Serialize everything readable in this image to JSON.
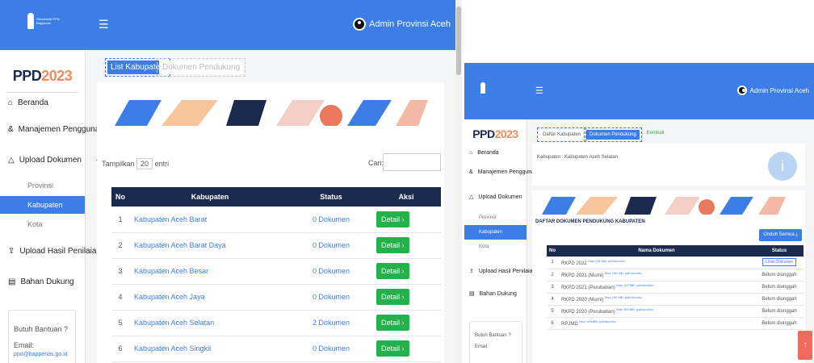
{
  "left": {
    "brand_line1": "Sekretariat PPD",
    "brand_line2": "Bappenas",
    "user_name": "Admin Provinsi Aceh",
    "logo_main": "PPD",
    "logo_year": "2023",
    "menu": {
      "beranda": "Beranda",
      "manajemen": "Manajemen Pengguna",
      "manajemen_toggle": "+",
      "upload": "Upload Dokumen",
      "upload_toggle": "–",
      "sub_provinsi": "Provinsi",
      "sub_kabupaten": "Kabupaten",
      "sub_kota": "Kota",
      "upload_hasil": "Upload Hasil Penilaian",
      "bahan": "Bahan Dukung"
    },
    "help": {
      "title": "Butuh Bantuan ?",
      "email_label": "Email:",
      "email": "ppd@bappenas.go.id"
    },
    "tabs": {
      "list": "List Kabupaten",
      "dok": "Dokumen Pendukung"
    },
    "length_prefix": "Tampilkan",
    "length_value": "20",
    "length_suffix": "entri",
    "search_label": "Cari:",
    "table": {
      "headers": [
        "No",
        "Kabupaten",
        "Status",
        "Aksi"
      ],
      "detail_label": "Detail ›",
      "rows": [
        {
          "no": "1",
          "name": "Kabupaten Aceh Barat",
          "status": "0 Dokumen"
        },
        {
          "no": "2",
          "name": "Kabupaten Aceh Barat Daya",
          "status": "0 Dokumen"
        },
        {
          "no": "3",
          "name": "Kabupaten Aceh Besar",
          "status": "0 Dokumen"
        },
        {
          "no": "4",
          "name": "Kabupaten Aceh Jaya",
          "status": "0 Dokumen"
        },
        {
          "no": "5",
          "name": "Kabupaten Aceh Selatan",
          "status": "2 Dokumen"
        },
        {
          "no": "6",
          "name": "Kabupaten Aceh Singkil",
          "status": "0 Dokumen"
        }
      ]
    }
  },
  "right": {
    "user_name": "Admin Provinsi Aceh",
    "logo_main": "PPD",
    "logo_year": "2023",
    "menu": {
      "beranda": "Beranda",
      "manajemen": "Manajemen Pengguna",
      "manajemen_toggle": "+",
      "upload": "Upload Dokumen",
      "upload_toggle": "–",
      "sub_provinsi": "Provinsi",
      "sub_kabupaten": "Kabupaten",
      "sub_kota": "Kota",
      "upload_hasil": "Upload Hasil Penilaian",
      "bahan": "Bahan Dukung"
    },
    "help": {
      "title": "Butuh Bantuan ?",
      "email_label": "Email:"
    },
    "tabs": {
      "daftar": "Daftar Kabupaten",
      "dok": "Dokumen Pendukung",
      "back": "← Kembali"
    },
    "kab_label": "Kabupaten : Kabupaten Aceh Selatan",
    "section_title": "DAFTAR DOKUMEN PENDUKUNG KABUPATEN",
    "unduh_label": "Unduh Semua",
    "table": {
      "headers": [
        "No",
        "Nama Dokumen",
        "Status"
      ],
      "rows": [
        {
          "no": "1",
          "name": "RKPD 2022",
          "note": "Max 100 MB, pdf/doc/xlsx",
          "status": "Lihat Dokumen"
        },
        {
          "no": "2",
          "name": "RKPD 2021 (Murni)",
          "note": "Max 100 MB, pdf/doc/xlsx",
          "status": "Belum diunggah"
        },
        {
          "no": "3",
          "name": "RKPD 2021 (Perubahan)",
          "note": "Max 100 MB, pdf/doc/xlsx",
          "status": "Belum diunggah"
        },
        {
          "no": "4",
          "name": "RKPD 2020 (Murni)",
          "note": "Max 100 MB, pdf/doc/xlsx",
          "status": "Belum diunggah"
        },
        {
          "no": "5",
          "name": "RKPD 2020 (Perubahan)",
          "note": "Max 100 MB, pdf/doc/xlsx",
          "status": "Belum diunggah"
        },
        {
          "no": "6",
          "name": "RPJMD",
          "note": "Max 100 MB, pdf/doc/xlsx",
          "status": "Belum diunggah"
        }
      ]
    }
  },
  "colors": {
    "primary": "#3d7ee6",
    "navy": "#1c2a4f",
    "green": "#22b14c",
    "accent": "#f08a5d"
  }
}
